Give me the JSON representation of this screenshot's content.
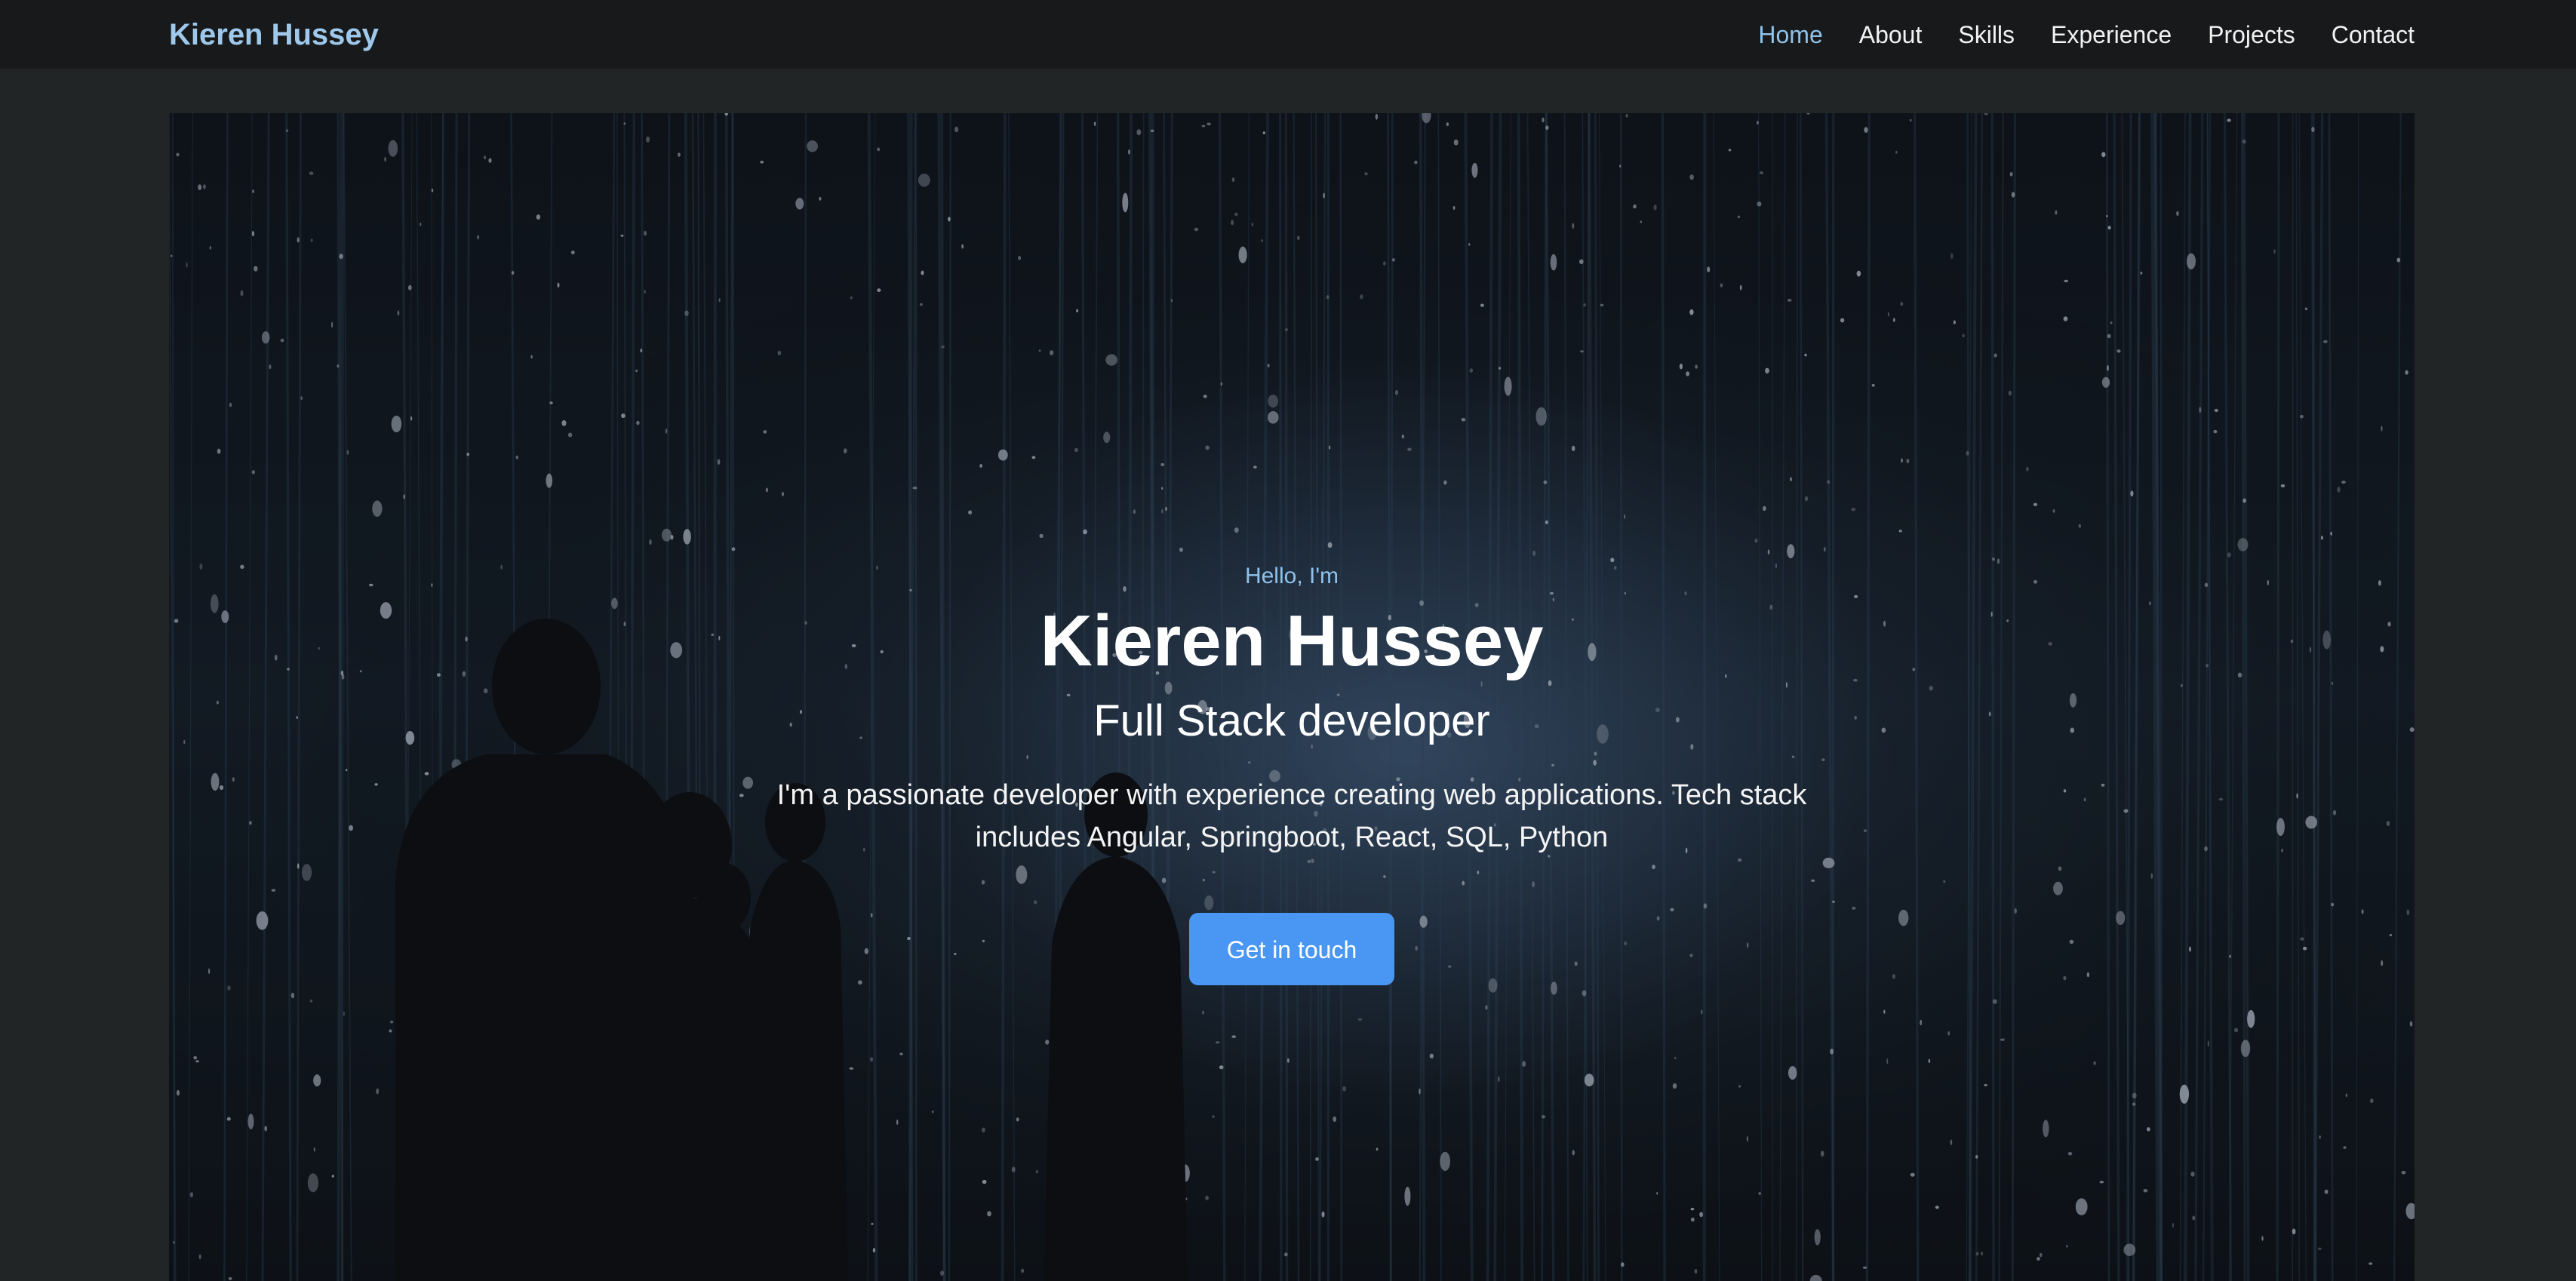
{
  "nav": {
    "brand": "Kieren Hussey",
    "links": [
      "Home",
      "About",
      "Skills",
      "Experience",
      "Projects",
      "Contact"
    ],
    "active": "Home"
  },
  "hero": {
    "greeting": "Hello, I'm",
    "name": "Kieren Hussey",
    "role": "Full Stack developer",
    "description": "I'm a passionate developer with experience creating web applications. Tech stack includes Angular, Springboot, React, SQL, Python",
    "cta_label": "Get in touch",
    "background_image": "night-light-installation-with-silhouettes"
  },
  "colors": {
    "accent": "#4a97f3",
    "brand": "#9fc9ec",
    "nav_active": "#8ec2ea",
    "navbar_bg": "#18191a",
    "page_bg": "#222526"
  }
}
